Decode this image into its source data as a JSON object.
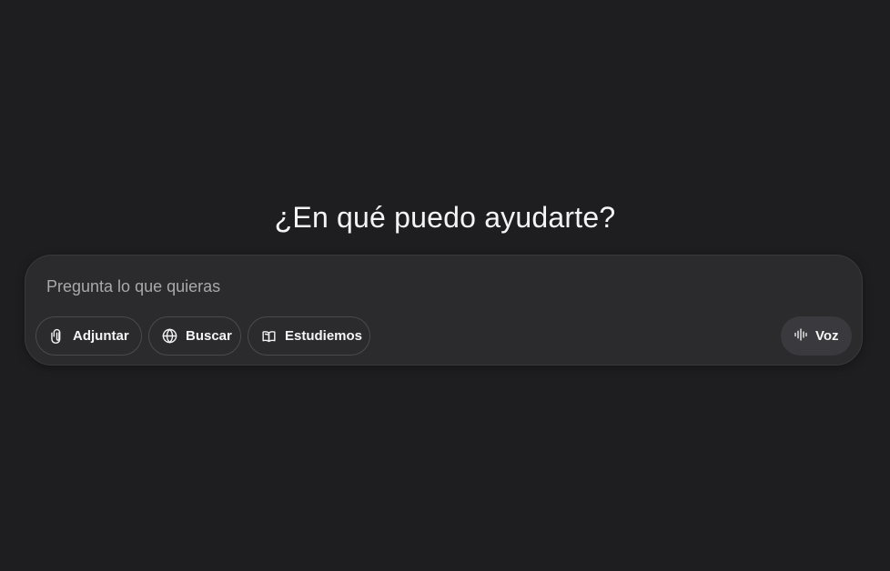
{
  "main": {
    "headline": "¿En qué puedo ayudarte?"
  },
  "composer": {
    "placeholder": "Pregunta lo que quieras",
    "buttons": {
      "attach": {
        "label": "Adjuntar",
        "icon": "paperclip-icon"
      },
      "search": {
        "label": "Buscar",
        "icon": "globe-icon"
      },
      "study": {
        "label": "Estudiemos",
        "icon": "open-book-icon"
      },
      "voice": {
        "label": "Voz",
        "icon": "voice-waveform-icon"
      }
    }
  },
  "colors": {
    "background": "#1e1e20",
    "composer_background": "#2b2b2e",
    "voice_button_background": "#3a3a3e",
    "text": "#f5f5f5",
    "placeholder": "#a8a8ad"
  }
}
